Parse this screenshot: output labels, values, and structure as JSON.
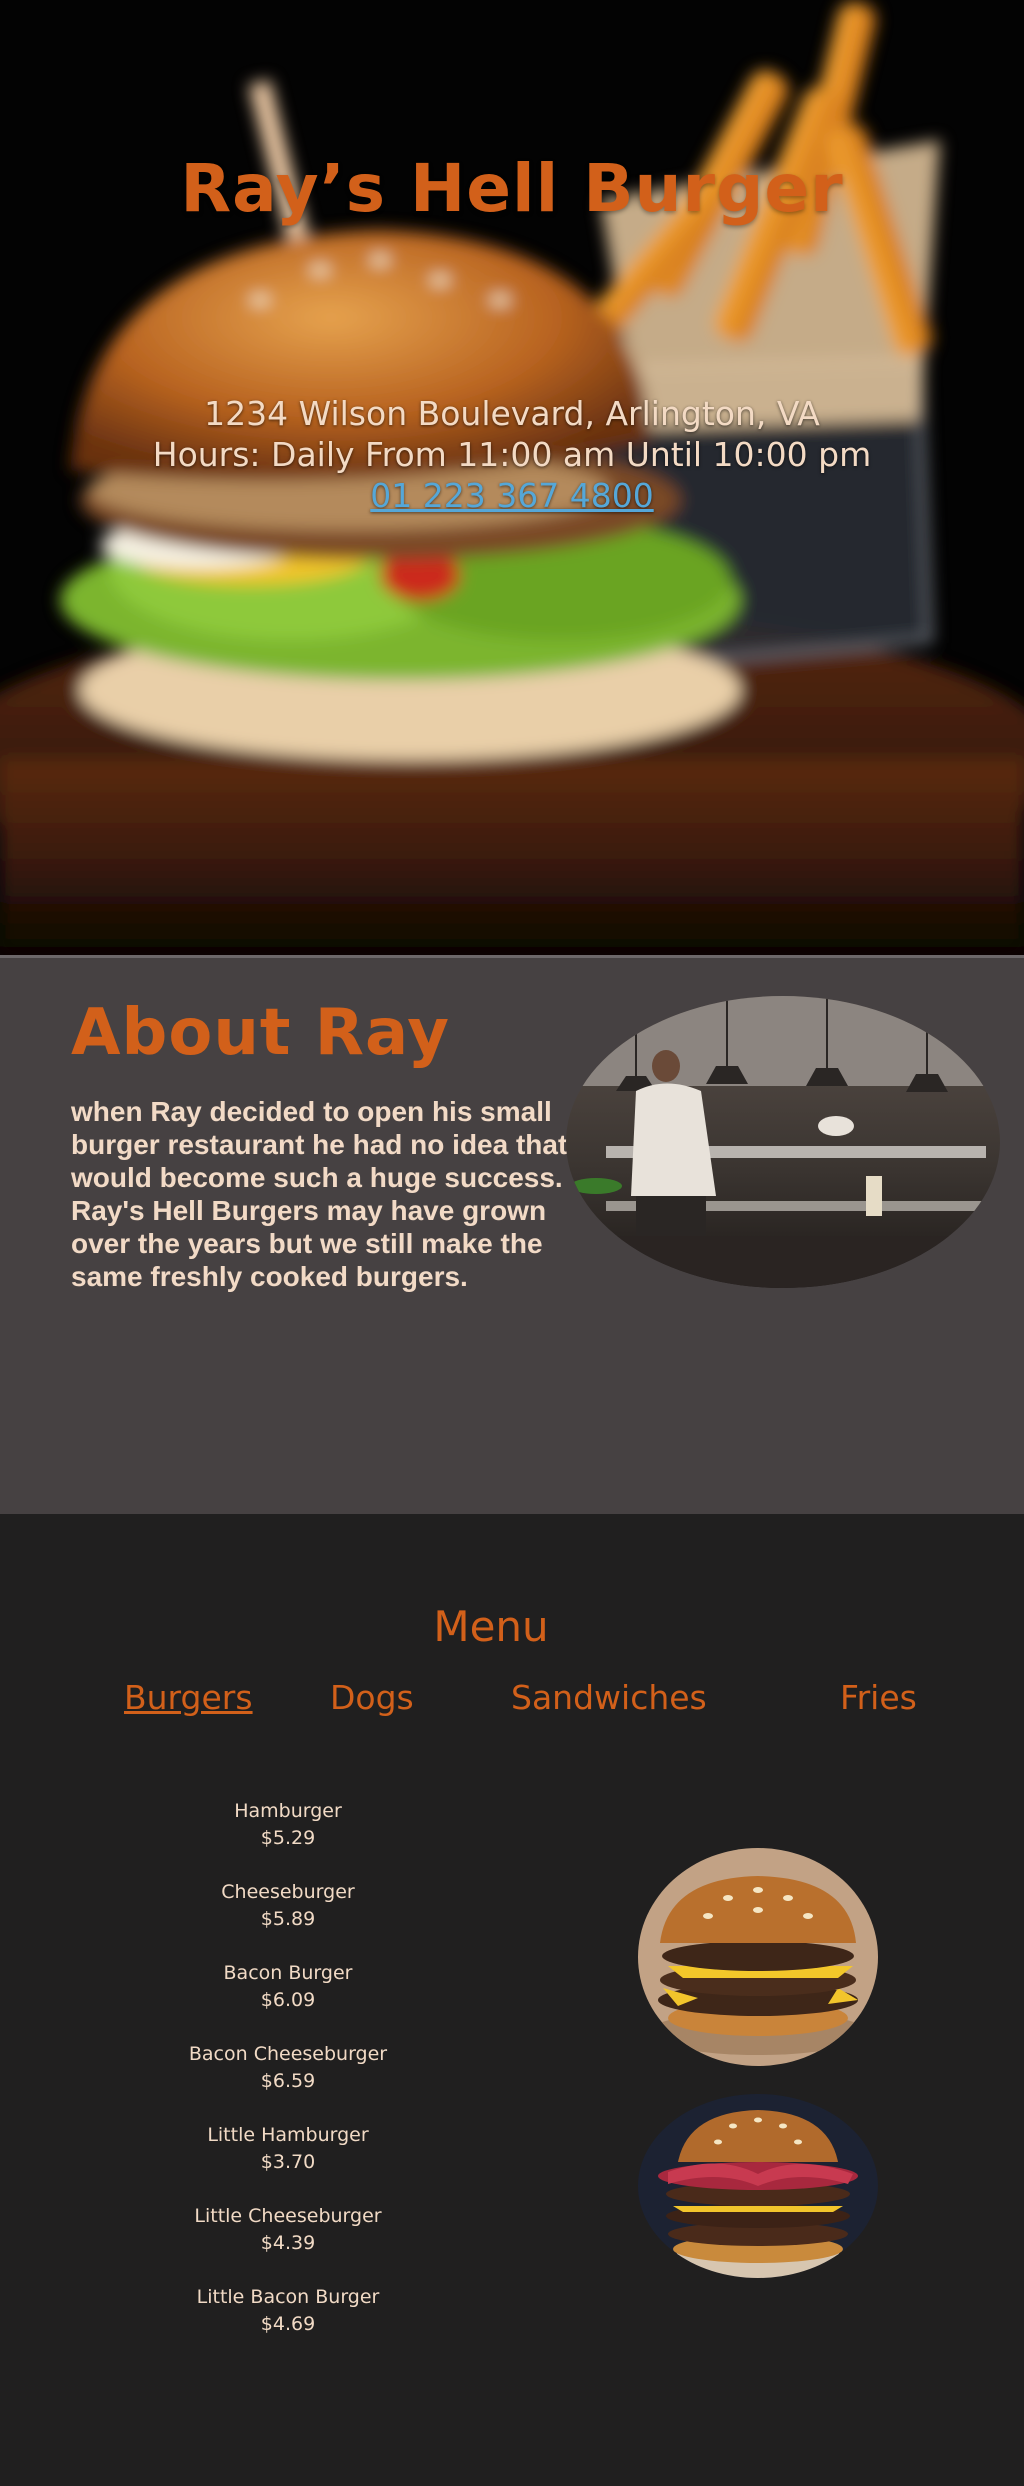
{
  "hero": {
    "title": "Ray’s Hell Burger",
    "address": "1234 Wilson Boulevard, Arlington, VA",
    "hours": "Hours: Daily From 11:00 am Until 10:00 pm",
    "phone": "01 223 367 4800"
  },
  "about": {
    "title": "About Ray",
    "text": "when Ray decided to open his small burger restaurant he had no idea that it would become such a huge success. Ray's Hell Burgers may have grown over the years but we still make the same freshly cooked burgers."
  },
  "menu": {
    "title": "Menu",
    "tabs": [
      {
        "label": "Burgers",
        "active": true
      },
      {
        "label": "Dogs"
      },
      {
        "label": "Sandwiches"
      },
      {
        "label": "Fries"
      }
    ],
    "items": [
      {
        "name": "Hamburger",
        "price": "$5.29"
      },
      {
        "name": "Cheeseburger",
        "price": "$5.89"
      },
      {
        "name": "Bacon Burger",
        "price": "$6.09"
      },
      {
        "name": "Bacon Cheeseburger",
        "price": "$6.59"
      },
      {
        "name": "Little Hamburger",
        "price": "$3.70"
      },
      {
        "name": "Little Cheeseburger",
        "price": "$4.39"
      },
      {
        "name": "Little Bacon Burger",
        "price": "$4.69"
      }
    ]
  },
  "colors": {
    "accent": "#d2601a",
    "link": "#55a7d8",
    "text": "#f2dac6",
    "about_bg": "#464142",
    "menu_bg": "#201f1f"
  }
}
